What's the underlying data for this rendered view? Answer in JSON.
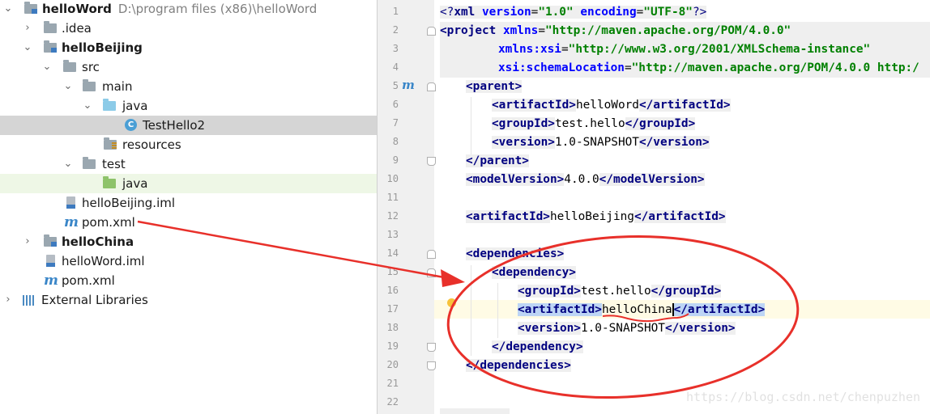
{
  "tree": {
    "root": {
      "label": "helloWord",
      "path": "D:\\program files (x86)\\helloWord"
    },
    "idea": ".idea",
    "helloBeijing": "helloBeijing",
    "src": "src",
    "main": "main",
    "java": "java",
    "testHello2": "TestHello2",
    "class_badge": "C",
    "resources": "resources",
    "test": "test",
    "test_java": "java",
    "beijing_iml": "helloBeijing.iml",
    "beijing_pom": "pom.xml",
    "helloChina": "helloChina",
    "word_iml": "helloWord.iml",
    "word_pom": "pom.xml",
    "maven_glyph": "m",
    "libs": "External Libraries"
  },
  "editor": {
    "line_numbers": [
      "1",
      "2",
      "3",
      "4",
      "5",
      "6",
      "7",
      "8",
      "9",
      "10",
      "11",
      "12",
      "13",
      "14",
      "15",
      "16",
      "17",
      "18",
      "19",
      "20",
      "21",
      "22"
    ],
    "maven_gutter_glyph": "m",
    "code": {
      "l1": {
        "a": "<?",
        "b": "xml ",
        "c": "version",
        "d": "=",
        "e": "\"1.0\"",
        "f": " ",
        "g": "encoding",
        "h": "=",
        "i": "\"UTF-8\"",
        "j": "?>"
      },
      "l2": {
        "a": "<project ",
        "b": "xmlns",
        "c": "=",
        "d": "\"http://maven.apache.org/POM/4.0.0\""
      },
      "l3": {
        "b": "xmlns:xsi",
        "c": "=",
        "d": "\"http://www.w3.org/2001/XMLSchema-instance\""
      },
      "l4": {
        "b": "xsi:schemaLocation",
        "c": "=",
        "d": "\"http://maven.apache.org/POM/4.0.0 http:/"
      },
      "l5": {
        "a": "<parent>"
      },
      "l6": {
        "a": "<artifactId>",
        "b": "helloWord",
        "c": "</artifactId>"
      },
      "l7": {
        "a": "<groupId>",
        "b": "test.hello",
        "c": "</groupId>"
      },
      "l8": {
        "a": "<version>",
        "b": "1.0-SNAPSHOT",
        "c": "</version>"
      },
      "l9": {
        "a": "</parent>"
      },
      "l10": {
        "a": "<modelVersion>",
        "b": "4.0.0",
        "c": "</modelVersion>"
      },
      "l12": {
        "a": "<artifactId>",
        "b": "helloBeijing",
        "c": "</artifactId>"
      },
      "l14": {
        "a": "<dependencies>"
      },
      "l15": {
        "a": "<dependency>"
      },
      "l16": {
        "a": "<groupId>",
        "b": "test.hello",
        "c": "</groupId>"
      },
      "l17": {
        "a": "<artifactId>",
        "b": "helloChina",
        "c": "</artifactId>"
      },
      "l18": {
        "a": "<version>",
        "b": "1.0-SNAPSHOT",
        "c": "</version>"
      },
      "l19": {
        "a": "</dependency>"
      },
      "l20": {
        "a": "</dependencies>"
      }
    }
  },
  "annotations": {
    "arrow_color": "#e8302a",
    "ellipse_color": "#e8302a"
  },
  "watermark": "https://blog.csdn.net/chenpuzhen"
}
